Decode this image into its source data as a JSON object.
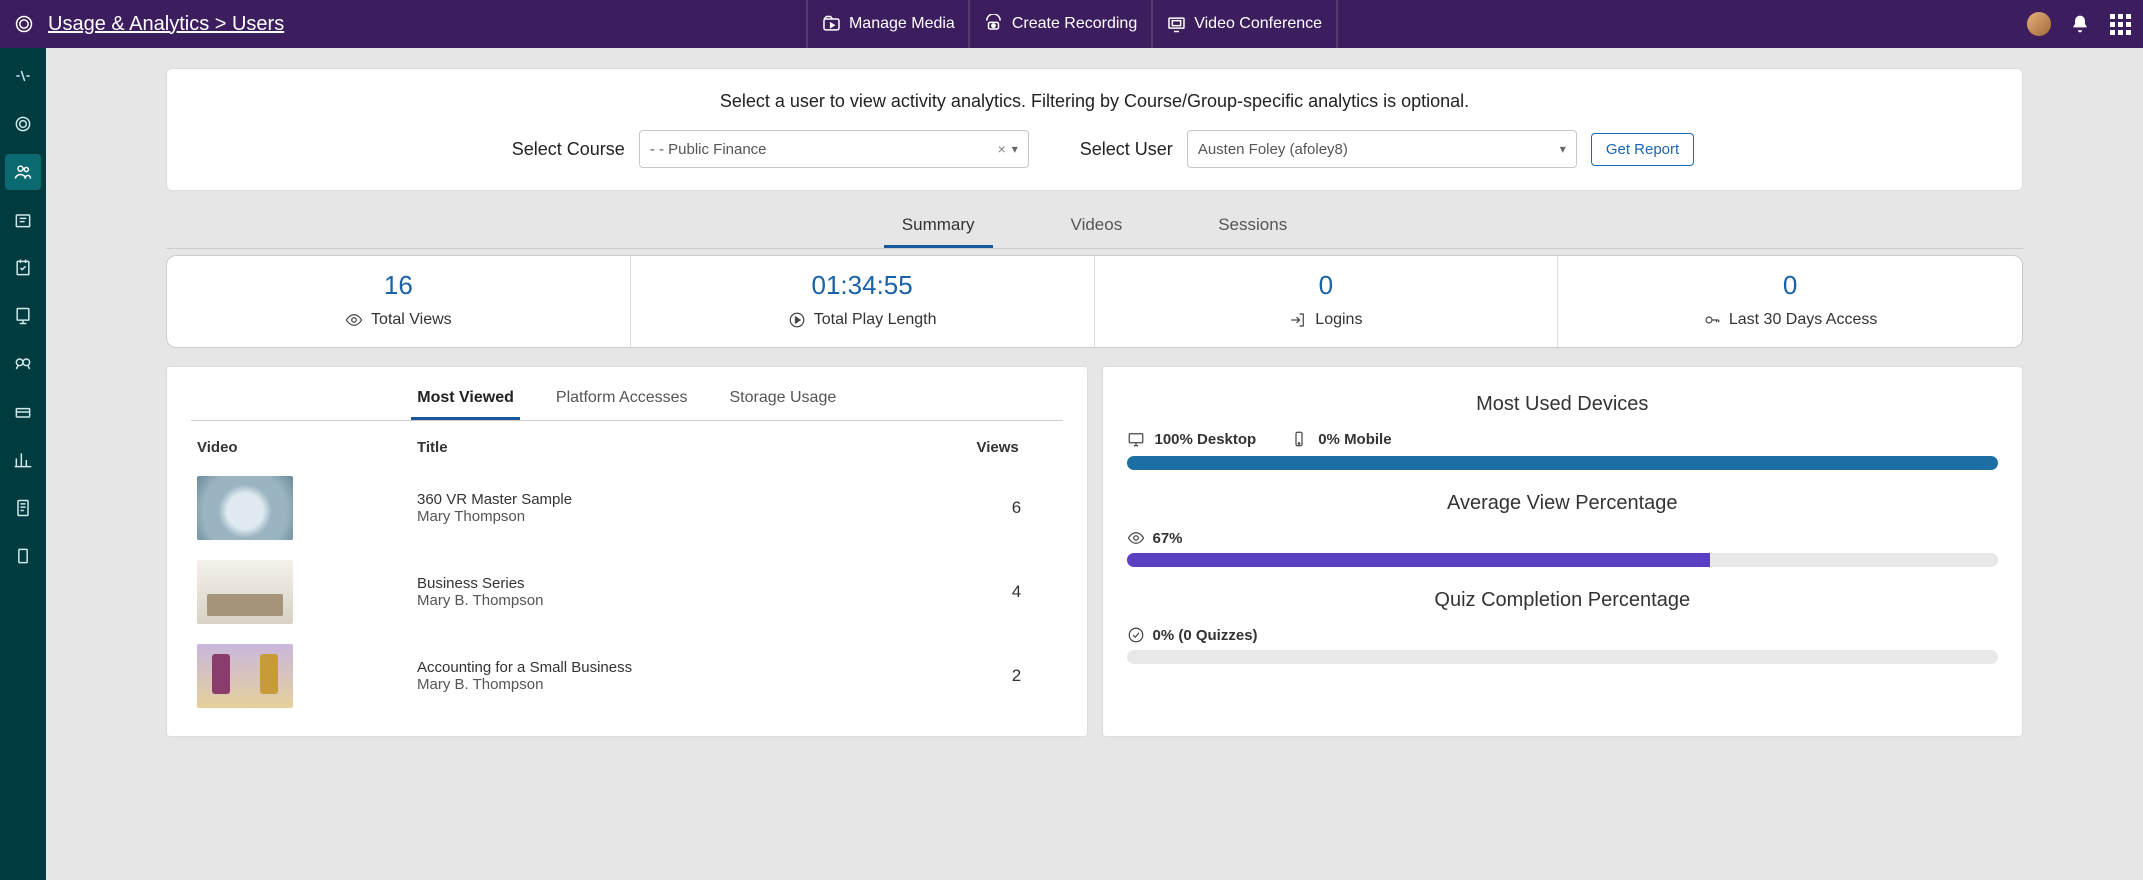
{
  "header": {
    "breadcrumb": "Usage & Analytics > Users",
    "actions": {
      "manage_media": "Manage Media",
      "create_recording": "Create Recording",
      "video_conference": "Video Conference"
    }
  },
  "filter": {
    "hint": "Select a user to view activity analytics. Filtering by Course/Group-specific analytics is optional.",
    "course_label": "Select Course",
    "course_value": "- - Public Finance",
    "user_label": "Select User",
    "user_value": "Austen Foley (afoley8)",
    "get_report": "Get Report"
  },
  "tabs": {
    "summary": "Summary",
    "videos": "Videos",
    "sessions": "Sessions"
  },
  "metrics": {
    "total_views_val": "16",
    "total_views_lbl": "Total Views",
    "play_length_val": "01:34:55",
    "play_length_lbl": "Total Play Length",
    "logins_val": "0",
    "logins_lbl": "Logins",
    "last30_val": "0",
    "last30_lbl": "Last 30 Days Access"
  },
  "subTabs": {
    "most_viewed": "Most Viewed",
    "platform_accesses": "Platform Accesses",
    "storage_usage": "Storage Usage"
  },
  "videoTable": {
    "head_video": "Video",
    "head_title": "Title",
    "head_views": "Views",
    "rows": [
      {
        "title": "360 VR Master Sample",
        "author": "Mary Thompson",
        "views": "6"
      },
      {
        "title": "Business Series",
        "author": "Mary B. Thompson",
        "views": "4"
      },
      {
        "title": "Accounting for a Small Business",
        "author": "Mary B. Thompson",
        "views": "2"
      }
    ]
  },
  "devices": {
    "heading": "Most Used Devices",
    "desktop_label": "100% Desktop",
    "mobile_label": "0% Mobile"
  },
  "avgView": {
    "heading": "Average View Percentage",
    "value": "67%"
  },
  "quiz": {
    "heading": "Quiz Completion Percentage",
    "value": "0% (0 Quizzes)"
  }
}
